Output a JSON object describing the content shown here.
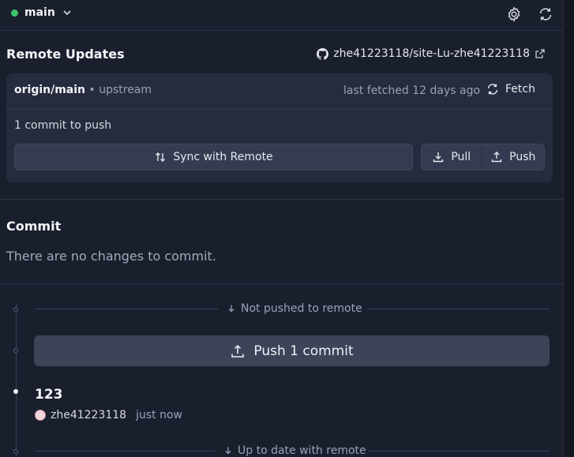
{
  "topbar": {
    "branch": "main",
    "status_color": "#3fc36a",
    "icons": [
      "gear-icon",
      "refresh-icon"
    ]
  },
  "remote": {
    "title": "Remote Updates",
    "repo": "zhe41223118/site-Lu-zhe41223118",
    "branch": "origin/main",
    "upstream": "upstream",
    "last_fetched": "last fetched 12 days ago",
    "fetch_label": "Fetch",
    "commit_count": "1 commit to push",
    "sync_label": "Sync with Remote",
    "pull_label": "Pull",
    "push_label": "Push"
  },
  "commit": {
    "title": "Commit",
    "empty_text": "There are no changes to commit."
  },
  "history": {
    "not_pushed_label": "Not pushed to remote",
    "push_button": "Push 1 commit",
    "commit_message": "123",
    "author": "zhe41223118",
    "time": "just now",
    "up_to_date_label": "Up to date with remote"
  }
}
